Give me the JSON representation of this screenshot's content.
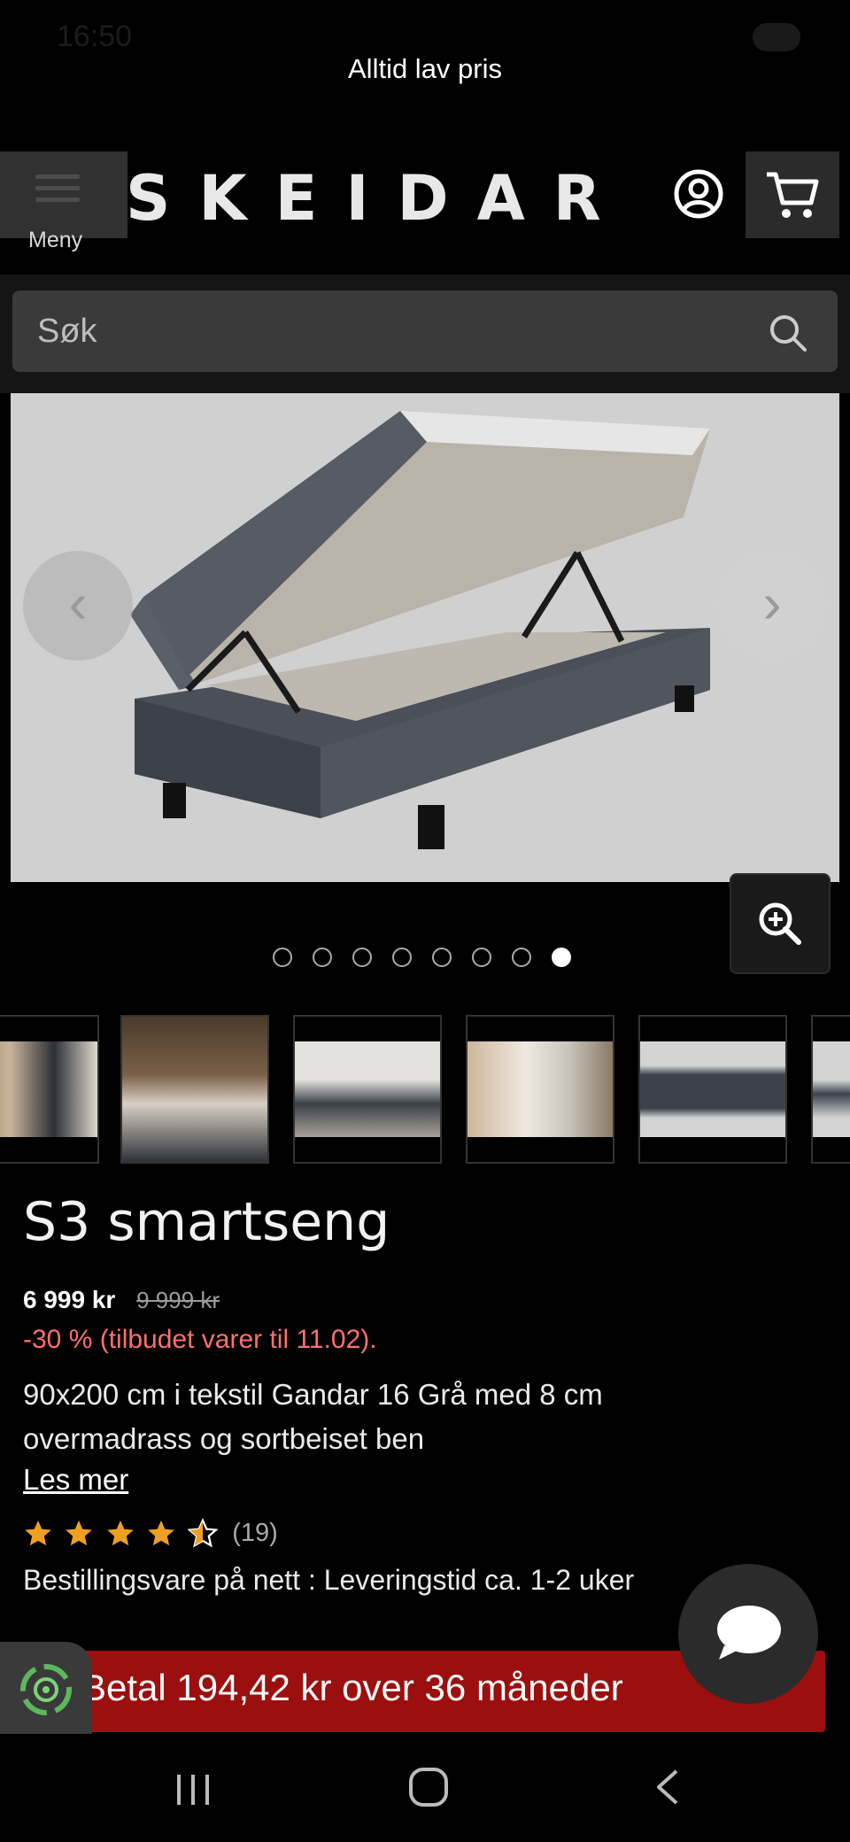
{
  "status_bar": {
    "time": "16:50"
  },
  "banner": {
    "text": "Alltid lav pris"
  },
  "header": {
    "menu_label": "Meny",
    "logo": "SKEIDAR"
  },
  "search": {
    "placeholder": "Søk"
  },
  "gallery": {
    "prev_glyph": "‹",
    "next_glyph": "›",
    "dot_count": 8,
    "active_dot": 8,
    "thumbnails": [
      "bedroom-headboard",
      "bed-closeup",
      "storage-bed-room",
      "bedroom-wide",
      "storage-bed-dark",
      "storage-bed-partial"
    ]
  },
  "product": {
    "title": "S3 smartseng",
    "price": "6 999 kr",
    "old_price": "9 999 kr",
    "discount": "-30 % (tilbudet varer til 11.02).",
    "description": "90x200 cm i tekstil Gandar 16 Grå med 8 cm overmadrass og sortbeiset ben",
    "read_more": "Les mer",
    "rating_stars": 4.5,
    "rating_count": "(19)",
    "availability": "Bestillingsvare på nett : Leveringstid ca. 1-2 uker"
  },
  "finance": {
    "text": "Betal 194,42 kr over 36 måneder"
  },
  "colors": {
    "accent_red": "#9b0f0f",
    "discount": "#ff6f6f",
    "star": "#f0a020"
  },
  "icons": {
    "menu": "hamburger-icon",
    "account": "account-icon",
    "cart": "cart-icon",
    "search": "search-icon",
    "zoom": "zoom-in-icon",
    "chat": "chat-icon",
    "badge": "recycle-badge-icon"
  }
}
